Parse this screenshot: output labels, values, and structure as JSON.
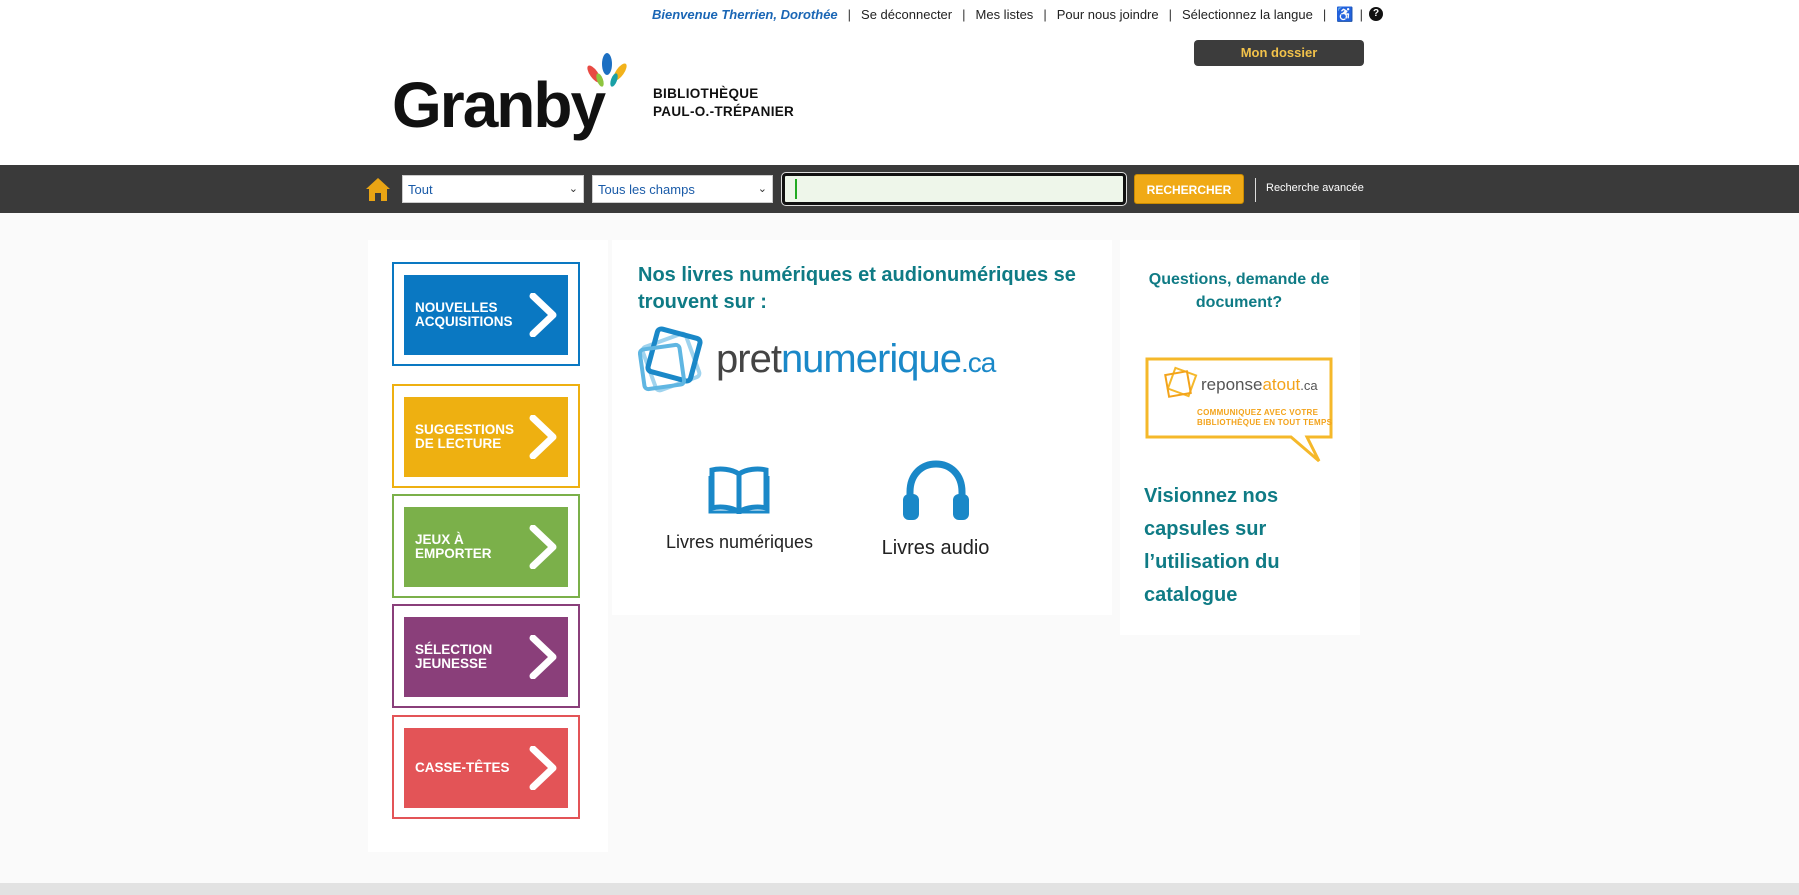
{
  "header": {
    "welcome": "Bienvenue Therrien, Dorothée",
    "links": [
      "Se déconnecter",
      "Mes listes",
      "Pour nous joindre",
      "Sélectionnez la langue"
    ],
    "mon_dossier": "Mon dossier",
    "logo_word": "Granby",
    "logo_sub_line1": "BIBLIOTHÈQUE",
    "logo_sub_line2": "PAUL-O.-TRÉPANIER"
  },
  "search": {
    "scope_value": "Tout",
    "field_value": "Tous les champs",
    "query_value": "",
    "search_button": "RECHERCHER",
    "advanced_link": "Recherche avancée"
  },
  "tiles": [
    {
      "label_line1": "NOUVELLES",
      "label_line2": "ACQUISITIONS",
      "color": "#0a78c2"
    },
    {
      "label_line1": "SUGGESTIONS",
      "label_line2": "DE LECTURE",
      "color": "#eeb011"
    },
    {
      "label_line1": "JEUX À",
      "label_line2": "EMPORTER",
      "color": "#7bb04a"
    },
    {
      "label_line1": "SÉLECTION",
      "label_line2": "JEUNESSE",
      "color": "#8a3f7a"
    },
    {
      "label_line1": "CASSE-TÊTES",
      "label_line2": "",
      "color": "#e35457"
    }
  ],
  "main": {
    "title": "Nos livres numériques et audionumériques se trouvent sur :",
    "brand_pret": "pret",
    "brand_numerique": "numerique",
    "brand_ca": ".ca",
    "ebooks_label": "Livres numériques",
    "audio_label": "Livres audio"
  },
  "sidebar_right": {
    "question_title": "Questions, demande de document?",
    "reponse_brand_1": "reponse",
    "reponse_brand_2": "atout",
    "reponse_brand_3": ".ca",
    "reponse_tagline_1": "COMMUNIQUEZ AVEC VOTRE",
    "reponse_tagline_2": "BIBLIOTHÈQUE EN TOUT TEMPS",
    "videos_text": "Visionnez nos capsules sur l’utilisation du catalogue"
  }
}
